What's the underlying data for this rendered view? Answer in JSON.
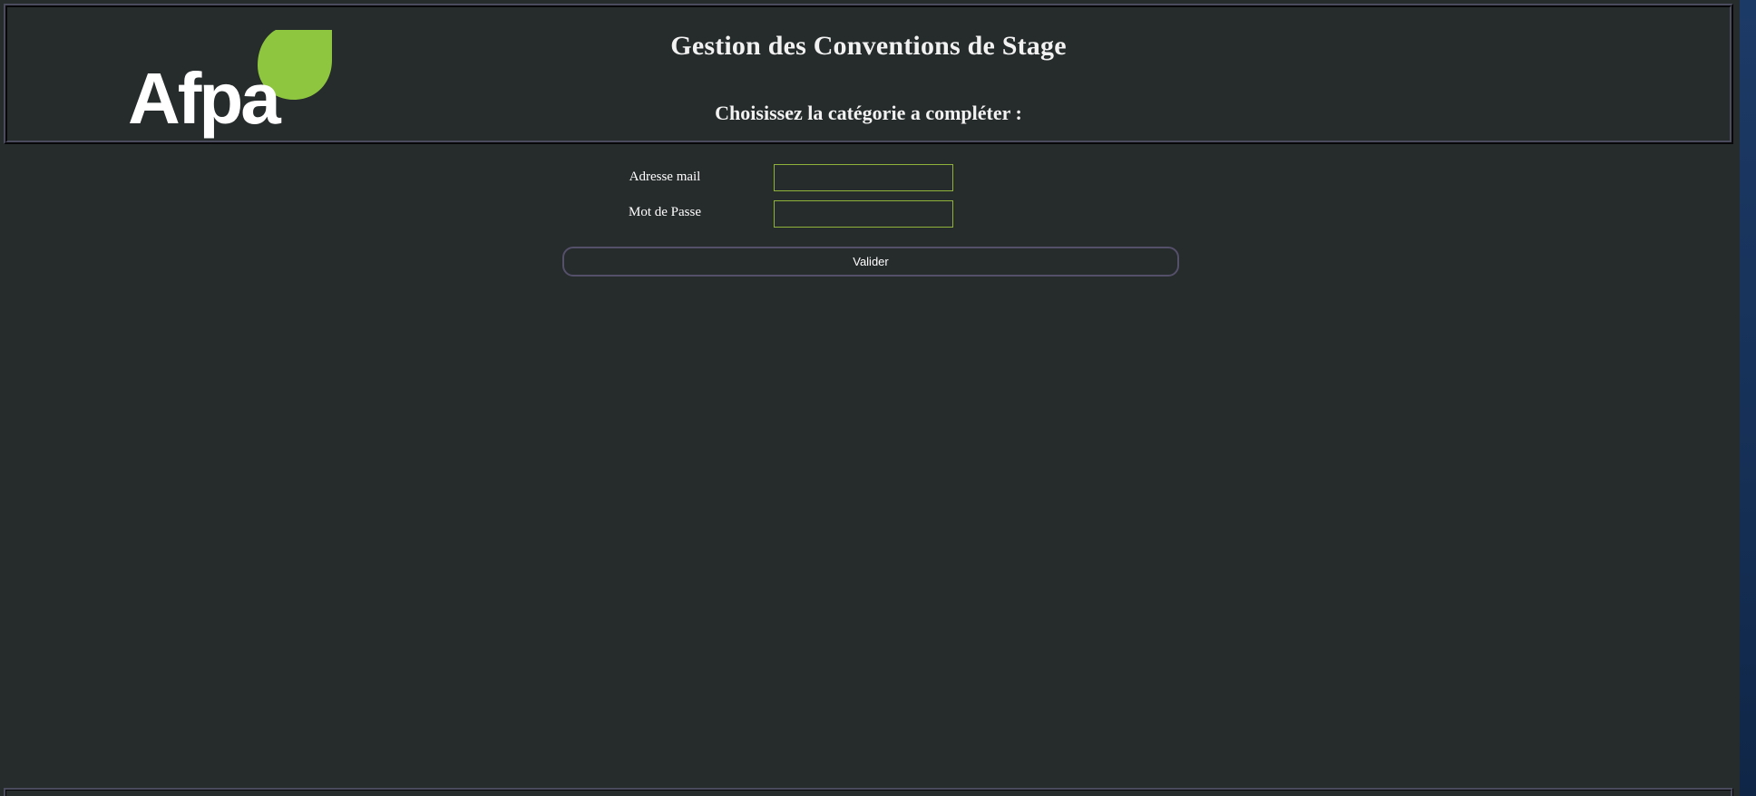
{
  "header": {
    "logo_text": "Afpa",
    "title": "Gestion des Conventions de Stage",
    "subtitle": "Choisissez la catégorie a compléter :"
  },
  "form": {
    "email_label": "Adresse mail",
    "email_value": "",
    "password_label": "Mot de Passe",
    "password_value": "",
    "submit_label": "Valider"
  },
  "colors": {
    "background": "#262b2c",
    "accent_green": "#8fb33a",
    "frame": "#4b4b5e",
    "text": "#ffffff"
  },
  "icons": {
    "logo": "afpa-leaf-logo"
  }
}
